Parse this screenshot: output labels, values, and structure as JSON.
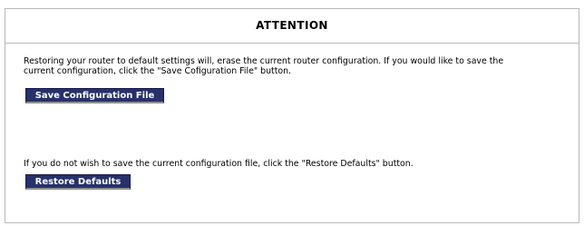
{
  "attention": {
    "title": "ATTENTION",
    "message_line1": "Restoring your router to default settings will, erase the current router configuration. If you would like to save the",
    "message_line2": "current configuration, click the \"Save Cofiguration File\" button.",
    "save_button_label": "Save Configuration File",
    "restore_message": "If you do not wish to save the current configuration file, click the \"Restore Defaults\" button.",
    "restore_button_label": "Restore Defaults"
  },
  "colors": {
    "button_bg": "#27316a",
    "button_text": "#ffffff",
    "border": "#b8b8b8"
  }
}
